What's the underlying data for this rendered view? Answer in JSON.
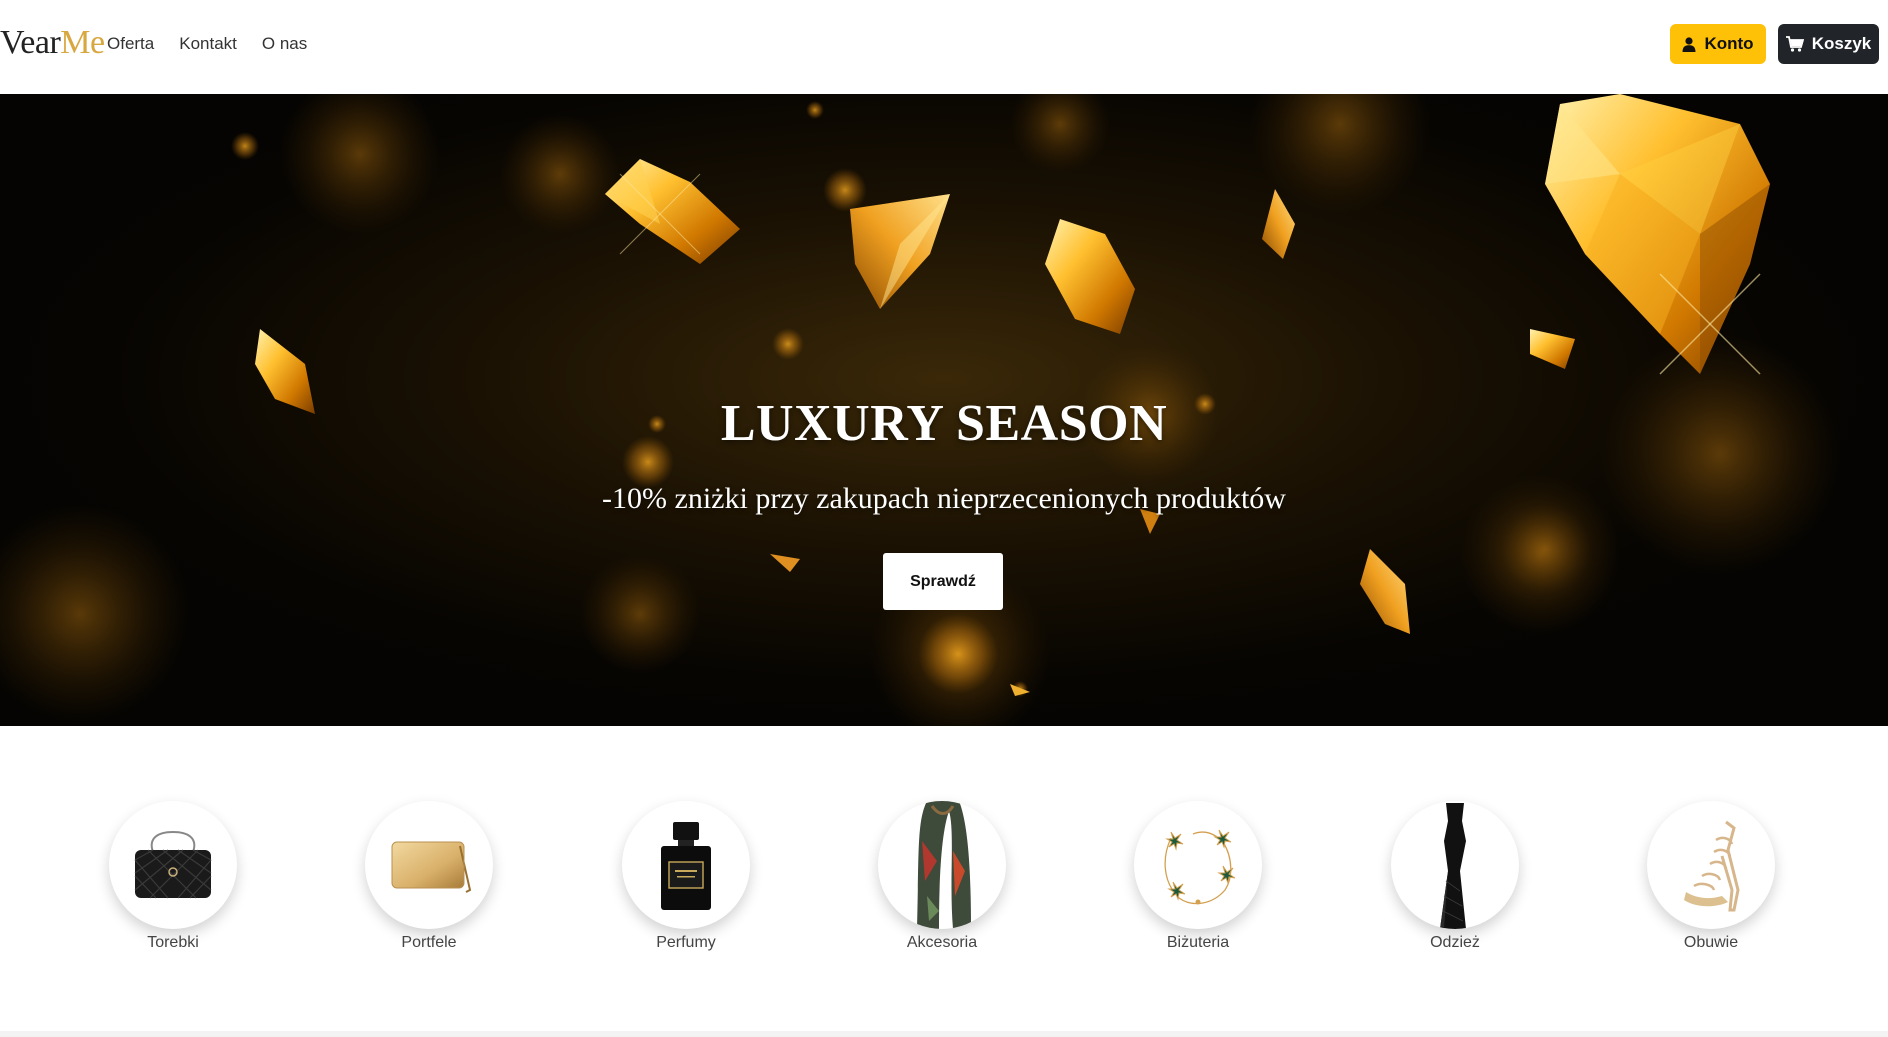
{
  "brand": {
    "part1": "Vear",
    "part2": "Me",
    "accent_color": "#d9a740"
  },
  "nav": {
    "links": [
      "Oferta",
      "Kontakt",
      "O nas"
    ]
  },
  "header_buttons": {
    "account": {
      "label": "Konto",
      "icon": "user-icon",
      "color": "#ffc107"
    },
    "cart": {
      "label": "Koszyk",
      "icon": "cart-icon",
      "color": "#212529"
    }
  },
  "hero": {
    "title": "LUXURY SEASON",
    "subtitle": "-10% zniżki przy zakupach nieprzecenionych produktów",
    "cta_label": "Sprawdź",
    "theme_colors": {
      "gold": "#f0a820",
      "dark": "#070502"
    }
  },
  "categories": [
    {
      "label": "Torebki",
      "icon": "handbag-icon"
    },
    {
      "label": "Portfele",
      "icon": "wallet-icon"
    },
    {
      "label": "Perfumy",
      "icon": "perfume-icon"
    },
    {
      "label": "Akcesoria",
      "icon": "scarf-icon"
    },
    {
      "label": "Biżuteria",
      "icon": "bracelet-icon"
    },
    {
      "label": "Odzież",
      "icon": "dress-icon"
    },
    {
      "label": "Obuwie",
      "icon": "sandal-icon"
    }
  ]
}
